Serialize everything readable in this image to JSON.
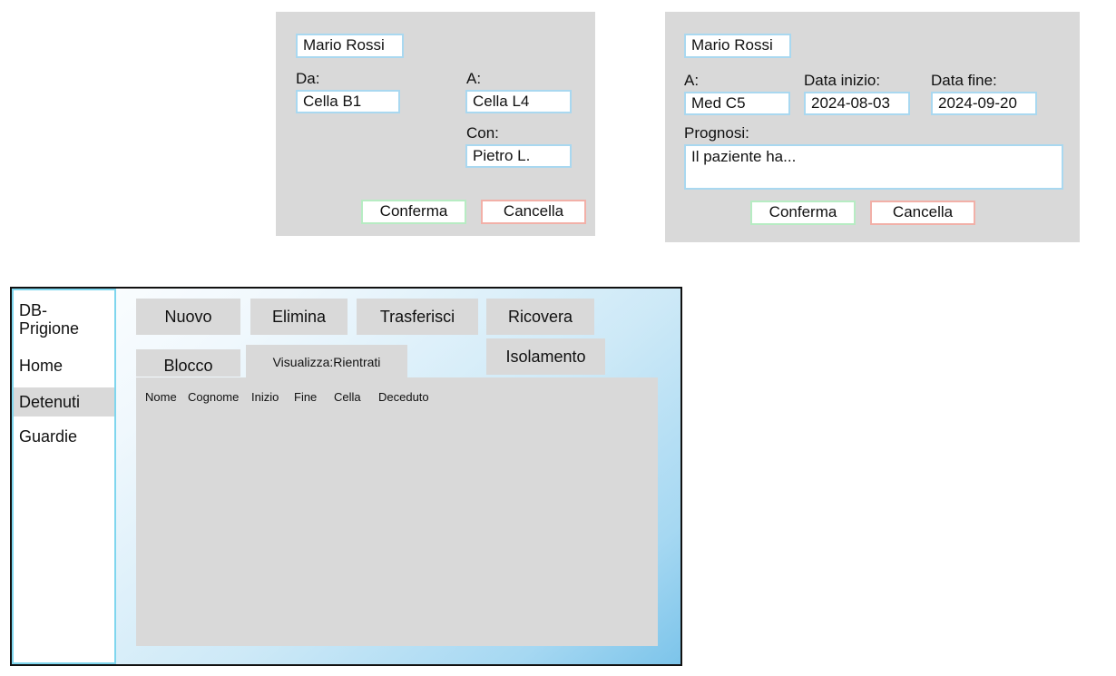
{
  "transfer_dialog": {
    "name": "Mario Rossi",
    "from_label": "Da:",
    "from_value": "Cella B1",
    "to_label": "A:",
    "to_value": "Cella L4",
    "with_label": "Con:",
    "with_value": "Pietro L.",
    "confirm_label": "Conferma",
    "cancel_label": "Cancella"
  },
  "hospital_dialog": {
    "name": "Mario Rossi",
    "to_label": "A:",
    "to_value": "Med C5",
    "start_label": "Data inizio:",
    "start_value": "2024-08-03",
    "end_label": "Data fine:",
    "end_value": "2024-09-20",
    "prognosis_label": "Prognosi:",
    "prognosis_value": "Il paziente ha...",
    "confirm_label": "Conferma",
    "cancel_label": "Cancella"
  },
  "sidebar": {
    "title": "DB-\nPrigione",
    "items": [
      {
        "label": "Home",
        "active": false
      },
      {
        "label": "Detenuti",
        "active": true
      },
      {
        "label": "Guardie",
        "active": false
      }
    ]
  },
  "toolbar": {
    "new_label": "Nuovo",
    "delete_label": "Elimina",
    "transfer_label": "Trasferisci",
    "hospitalize_label": "Ricovera",
    "block_label": "Blocco",
    "view_label": "Visualizza:Rientrati",
    "isolation_label": "Isolamento"
  },
  "table": {
    "columns": [
      "Nome",
      "Cognome",
      "Inizio",
      "Fine",
      "Cella",
      "Deceduto"
    ]
  },
  "colors": {
    "field_border": "#a9d8f0",
    "confirm_border": "#b7ecc3",
    "cancel_border": "#f2b0a8",
    "panel_bg": "#d9d9d9",
    "sidebar_border": "#7fd6ee"
  }
}
